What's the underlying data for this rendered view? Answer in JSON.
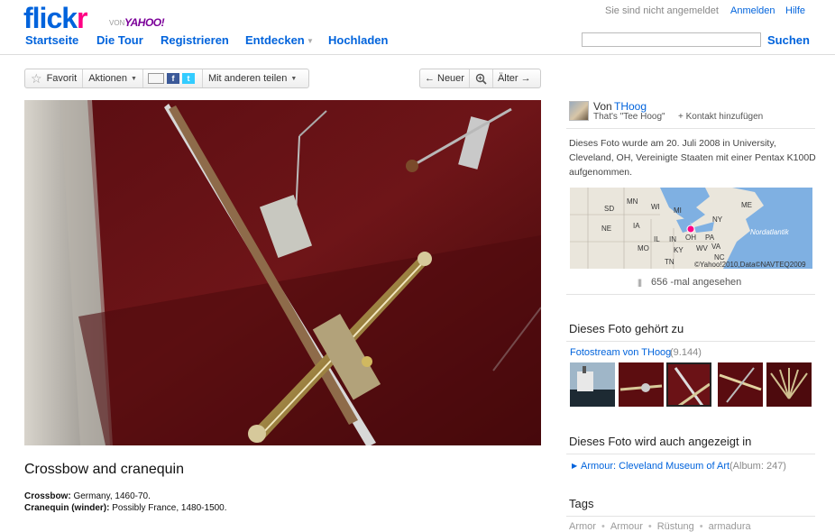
{
  "brand": {
    "logo_main": "flick",
    "logo_r": "r",
    "logo_von": "VON",
    "logo_yahoo": "YAHOO!"
  },
  "topbar": {
    "status": "Sie sind nicht angemeldet",
    "login": "Anmelden",
    "help": "Hilfe"
  },
  "nav": {
    "items": [
      "Startseite",
      "Die Tour",
      "Registrieren",
      "Entdecken",
      "Hochladen"
    ],
    "search_value": "",
    "search_button": "Suchen"
  },
  "toolbar": {
    "favorite": "Favorit",
    "actions": "Aktionen",
    "share": "Mit anderen teilen",
    "newer": "Neuer",
    "older": "Älter",
    "fb": "f",
    "tw": "t"
  },
  "photo": {
    "title": "Crossbow and cranequin",
    "desc_line1_label": "Crossbow:",
    "desc_line1_value": " Germany, 1460-70.",
    "desc_line2_label": "Cranequin (winder):",
    "desc_line2_value": " Possibly France, 1480-1500."
  },
  "owner": {
    "prefix": "Von",
    "name": "THoog",
    "realname": "That's \"Tee Hoog\"",
    "add_contact": "+ Kontakt hinzufügen"
  },
  "taken": "Dieses Foto wurde am 20. Juli 2008 in University, Cleveland, OH, Vereinigte Staaten mit einer Pentax K100D aufgenommen.",
  "map": {
    "labels": [
      "SD",
      "MN",
      "WI",
      "MI",
      "NE",
      "IA",
      "IL",
      "IN",
      "OH",
      "PA",
      "NY",
      "ME",
      "MO",
      "KY",
      "WV",
      "VA",
      "TN",
      "NC",
      "Nordatlantik"
    ],
    "credit": "©Yahoo!2010,Data©NAVTEQ2009"
  },
  "views": "656 -mal angesehen",
  "belongs": {
    "heading": "Dieses Foto gehört zu",
    "stream": "Fotostream von THoog",
    "stream_count": "(9.144)"
  },
  "also": {
    "heading": "Dieses Foto wird auch angezeigt in",
    "album": "Armour: Cleveland Museum of Art",
    "album_count": "(Album: 247)"
  },
  "tags": {
    "heading": "Tags",
    "items": [
      "Armor",
      "Armour",
      "Rüstung",
      "armadura"
    ]
  },
  "colors": {
    "flickr_blue": "#0063dc",
    "flickr_pink": "#ff0084",
    "yahoo_purple": "#7b0099"
  }
}
